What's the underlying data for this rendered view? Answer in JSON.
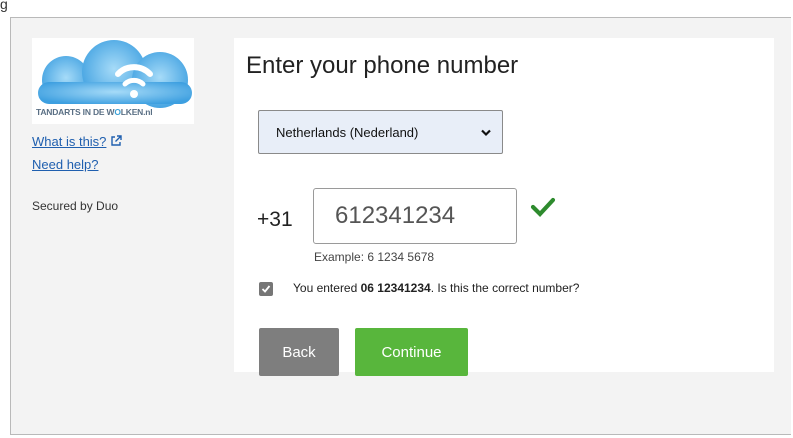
{
  "page": {
    "top_fragment": "g"
  },
  "sidebar": {
    "logo_text_a": "TANDARTS IN DE W",
    "logo_text_b": "O",
    "logo_text_c": "LKEN.nl",
    "what_is_this": "What is this?",
    "need_help": "Need help?",
    "secured_by": "Secured by Duo"
  },
  "main": {
    "title": "Enter your phone number",
    "country_select": {
      "selected": "Netherlands (Nederland)"
    },
    "country_code": "+31",
    "phone_value": "612341234",
    "example": "Example: 6 1234 5678",
    "confirm": {
      "checked": true,
      "prefix": "You entered ",
      "number": "06 12341234",
      "suffix": ". Is this the correct number?"
    },
    "buttons": {
      "back": "Back",
      "continue": "Continue"
    }
  },
  "colors": {
    "continue_bg": "#58b63c",
    "back_bg": "#7e7e7e",
    "valid_check": "#2e8b2e",
    "link": "#1f5faf"
  },
  "icons": {
    "external": "external-link-icon",
    "valid": "checkmark-icon",
    "chevron": "chevron-down-icon",
    "checkbox": "checkbox-checked-icon"
  }
}
